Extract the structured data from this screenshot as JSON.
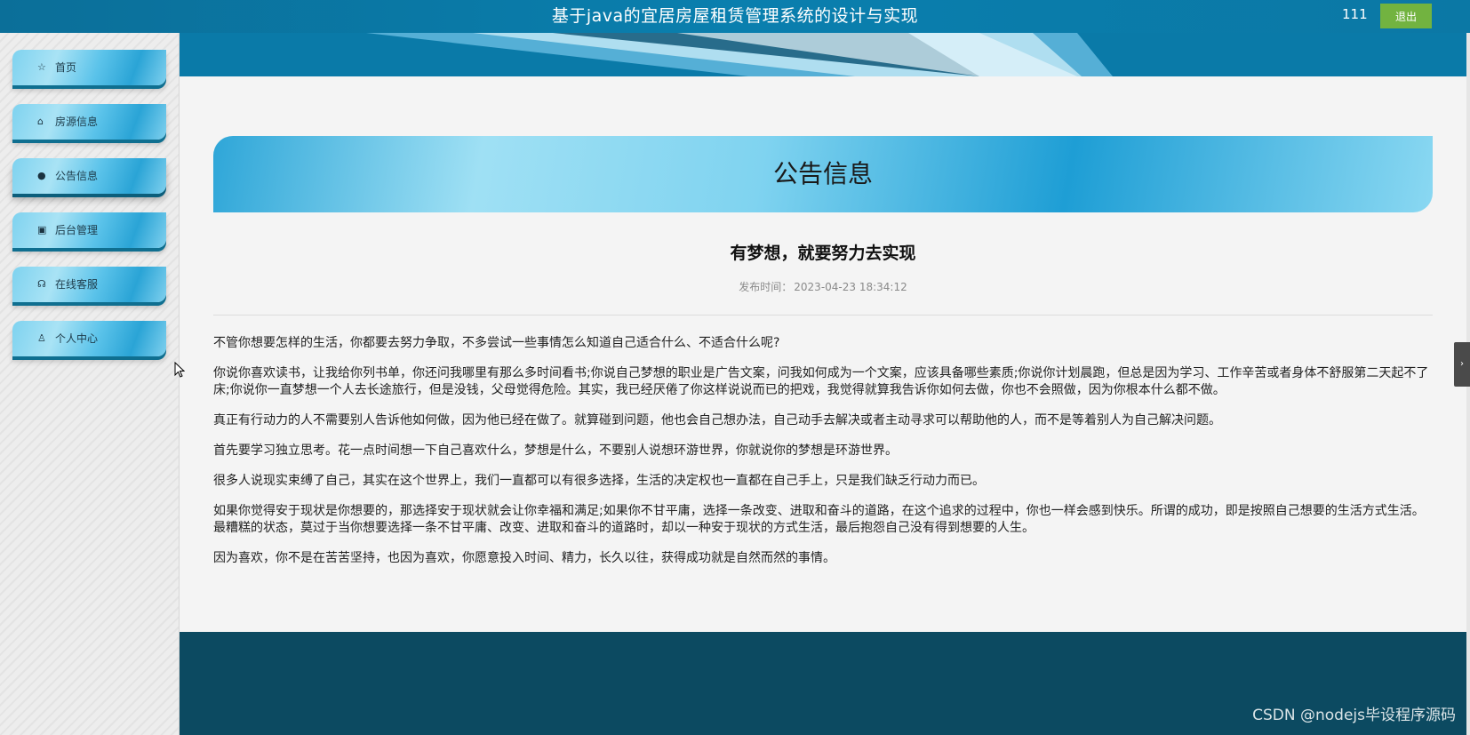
{
  "header": {
    "title": "基于java的宜居房屋租赁管理系统的设计与实现",
    "username": "111",
    "logout_label": "退出"
  },
  "sidebar": {
    "items": [
      {
        "label": "首页",
        "icon": "star-icon",
        "glyph": "☆"
      },
      {
        "label": "房源信息",
        "icon": "shopping-bag-icon",
        "glyph": "⌂"
      },
      {
        "label": "公告信息",
        "icon": "alert-circle-icon",
        "glyph": "●"
      },
      {
        "label": "后台管理",
        "icon": "calendar-icon",
        "glyph": "▣"
      },
      {
        "label": "在线客服",
        "icon": "headset-icon",
        "glyph": "☊"
      },
      {
        "label": "个人中心",
        "icon": "user-icon",
        "glyph": "♙"
      }
    ],
    "active_index": 2
  },
  "main": {
    "section_title": "公告信息",
    "article": {
      "title": "有梦想，就要努力去实现",
      "date_label": "发布时间：",
      "date_value": "2023-04-23 18:34:12",
      "paragraphs": [
        "不管你想要怎样的生活，你都要去努力争取，不多尝试一些事情怎么知道自己适合什么、不适合什么呢?",
        "你说你喜欢读书，让我给你列书单，你还问我哪里有那么多时间看书;你说自己梦想的职业是广告文案，问我如何成为一个文案，应该具备哪些素质;你说你计划晨跑，但总是因为学习、工作辛苦或者身体不舒服第二天起不了床;你说你一直梦想一个人去长途旅行，但是没钱，父母觉得危险。其实，我已经厌倦了你这样说说而已的把戏，我觉得就算我告诉你如何去做，你也不会照做，因为你根本什么都不做。",
        "真正有行动力的人不需要别人告诉他如何做，因为他已经在做了。就算碰到问题，他也会自己想办法，自己动手去解决或者主动寻求可以帮助他的人，而不是等着别人为自己解决问题。",
        "首先要学习独立思考。花一点时间想一下自己喜欢什么，梦想是什么，不要别人说想环游世界，你就说你的梦想是环游世界。",
        "很多人说现实束缚了自己，其实在这个世界上，我们一直都可以有很多选择，生活的决定权也一直都在自己手上，只是我们缺乏行动力而已。",
        "如果你觉得安于现状是你想要的，那选择安于现状就会让你幸福和满足;如果你不甘平庸，选择一条改变、进取和奋斗的道路，在这个追求的过程中，你也一样会感到快乐。所谓的成功，即是按照自己想要的生活方式生活。最糟糕的状态，莫过于当你想要选择一条不甘平庸、改变、进取和奋斗的道路时，却以一种安于现状的方式生活，最后抱怨自己没有得到想要的人生。",
        "因为喜欢，你不是在苦苦坚持，也因为喜欢，你愿意投入时间、精力，长久以往，获得成功就是自然而然的事情。"
      ]
    }
  },
  "footer": {
    "watermark": "CSDN @nodejs毕设程序源码"
  },
  "colors": {
    "topbar": "#0a7fae",
    "logout_button": "#72b340",
    "footer": "#0c4a61",
    "nav_gradient_mid": "#5bc3ea"
  }
}
